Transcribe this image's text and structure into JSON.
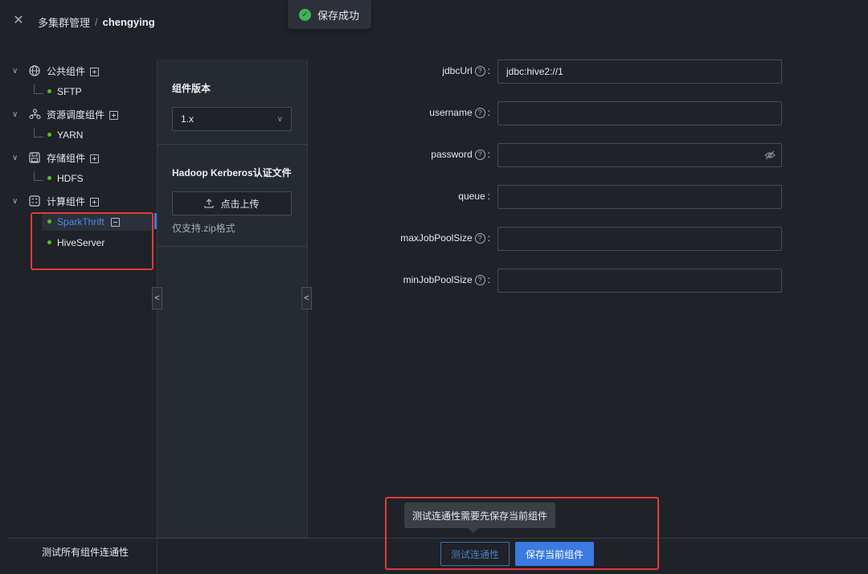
{
  "header": {
    "breadcrumb_parent": "多集群管理",
    "breadcrumb_sep": "/",
    "breadcrumb_current": "chengying"
  },
  "toast": {
    "message": "保存成功"
  },
  "tree": {
    "groups": [
      {
        "label": "公共组件",
        "icon": "globe-icon",
        "children": [
          "SFTP"
        ]
      },
      {
        "label": "资源调度组件",
        "icon": "schedule-icon",
        "children": [
          "YARN"
        ]
      },
      {
        "label": "存储组件",
        "icon": "save-icon",
        "children": [
          "HDFS"
        ]
      },
      {
        "label": "计算组件",
        "icon": "calc-icon",
        "children": [
          "SparkThrift",
          "HiveServer"
        ]
      }
    ],
    "active_leaf": "SparkThrift"
  },
  "middle": {
    "version_title": "组件版本",
    "version_value": "1.x",
    "kerberos_title": "Hadoop Kerberos认证文件",
    "upload_label": "点击上传",
    "upload_hint": "仅支持.zip格式"
  },
  "form": {
    "fields": [
      {
        "label": "jdbcUrl",
        "value": "jdbc:hive2://1",
        "colon": ":"
      },
      {
        "label": "username",
        "value": "",
        "colon": ":"
      },
      {
        "label": "password",
        "value": "",
        "colon": ":"
      },
      {
        "label": "queue",
        "value": "",
        "colon": ":"
      },
      {
        "label": "maxJobPoolSize",
        "value": "",
        "colon": ":"
      },
      {
        "label": "minJobPoolSize",
        "value": "",
        "colon": ":"
      }
    ]
  },
  "bottom": {
    "test_all_label": "测试所有组件连通性",
    "tooltip": "测试连通性需要先保存当前组件",
    "test_button": "测试连通性",
    "save_button": "保存当前组件"
  },
  "colors": {
    "accent": "#3b7ae0",
    "success": "#3fb45a",
    "highlight_border": "#e23b3b",
    "status_dot": "#52c41a"
  }
}
